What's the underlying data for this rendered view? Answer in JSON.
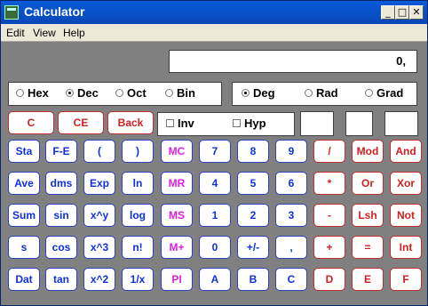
{
  "window": {
    "title": "Calculator",
    "controls": {
      "minimize": "_",
      "maximize": "□",
      "close": "✕"
    }
  },
  "menu": {
    "items": [
      "Edit",
      "View",
      "Help"
    ]
  },
  "display": {
    "value": "0,"
  },
  "base": {
    "options": [
      "Hex",
      "Dec",
      "Oct",
      "Bin"
    ],
    "selected": "Dec"
  },
  "angle": {
    "options": [
      "Deg",
      "Rad",
      "Grad"
    ],
    "selected": "Deg"
  },
  "clear": {
    "c": "C",
    "ce": "CE",
    "back": "Back"
  },
  "checks": {
    "inv": "Inv",
    "hyp": "Hyp"
  },
  "rows": [
    [
      "Sta",
      "F-E",
      "(",
      ")",
      "MC",
      "7",
      "8",
      "9",
      "/",
      "Mod",
      "And"
    ],
    [
      "Ave",
      "dms",
      "Exp",
      "ln",
      "MR",
      "4",
      "5",
      "6",
      "*",
      "Or",
      "Xor"
    ],
    [
      "Sum",
      "sin",
      "x^y",
      "log",
      "MS",
      "1",
      "2",
      "3",
      "-",
      "Lsh",
      "Not"
    ],
    [
      "s",
      "cos",
      "x^3",
      "n!",
      "M+",
      "0",
      "+/-",
      ",",
      "+",
      "=",
      "Int"
    ],
    [
      "Dat",
      "tan",
      "x^2",
      "1/x",
      "PI",
      "A",
      "B",
      "C",
      "D",
      "E",
      "F"
    ]
  ]
}
